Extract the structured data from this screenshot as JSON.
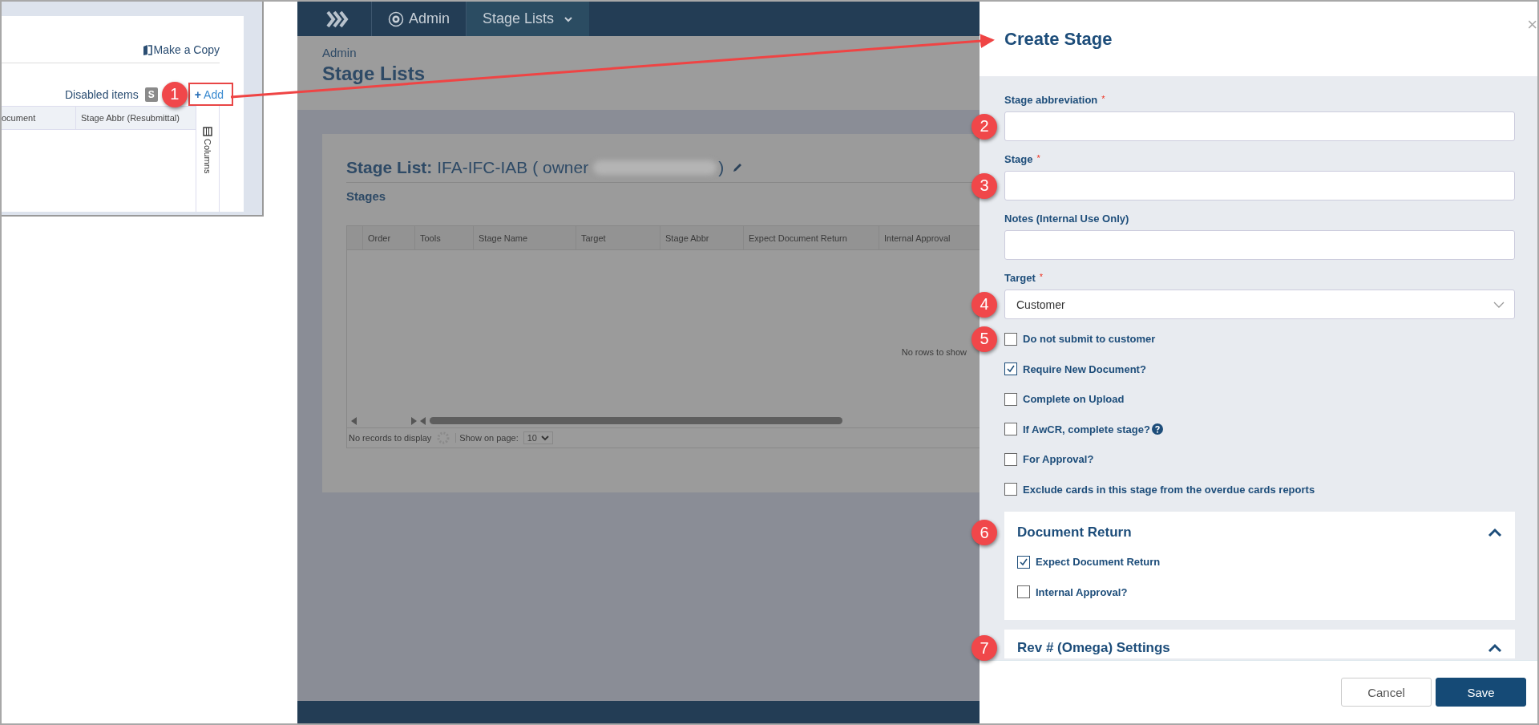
{
  "inset": {
    "make_copy": "Make a Copy",
    "disabled_items": "Disabled items",
    "badge": "S",
    "add_button": {
      "icon": "+",
      "label": "Add",
      "callout": "1"
    },
    "columns": [
      "ocument",
      "Stage Abbr (Resubmittal)"
    ],
    "columns_tab": "Columns"
  },
  "nav": {
    "crumbs": [
      {
        "label": "Admin",
        "kind": "gear",
        "selected": false
      },
      {
        "label": "Stage Lists",
        "kind": "dropdown",
        "selected": true
      }
    ]
  },
  "page": {
    "breadcrumb": "Admin",
    "title": "Stage Lists"
  },
  "stage_list": {
    "heading": "**Stage List:** IFA-IFC-IAB ( owner",
    "heading_end": ")",
    "section": "Stages"
  },
  "table": {
    "columns": [
      "Order",
      "Tools",
      "Stage Name",
      "Target",
      "Stage Abbr",
      "Expect Document Return",
      "Internal Approval"
    ],
    "empty": "No rows to show",
    "records": "No records to display",
    "show_label": "Show on page:",
    "page_size": "10"
  },
  "panel": {
    "title": "Create Stage",
    "close": "×",
    "fields": [
      {
        "label": "Stage abbreviation",
        "required_mark": "*",
        "kind": "text",
        "callout": "2"
      },
      {
        "label": "Stage",
        "required_mark": "*",
        "kind": "text",
        "callout": "3"
      },
      {
        "label": "Notes (Internal Use Only)",
        "kind": "text"
      },
      {
        "label": "Target",
        "required_mark": "*",
        "kind": "select",
        "value": "Customer",
        "callout": "4"
      }
    ],
    "checkboxes": [
      {
        "label": "Do not submit to customer",
        "checked": false,
        "help": false,
        "callout": "5"
      },
      {
        "label": "Require New Document?",
        "checked": true,
        "help": false
      },
      {
        "label": "Complete on Upload",
        "checked": false,
        "help": false
      },
      {
        "label": "If AwCR, complete stage?",
        "checked": false,
        "help": true
      },
      {
        "label": "For Approval?",
        "checked": false,
        "help": false
      },
      {
        "label": "Exclude cards in this stage from the overdue cards reports",
        "checked": false,
        "help": false
      }
    ],
    "sections": [
      {
        "title": "Document Return",
        "expanded": true,
        "callout": "6",
        "checkboxes": [
          {
            "label": "Expect Document Return",
            "checked": true,
            "help": false
          },
          {
            "label": "Internal Approval?",
            "checked": false,
            "help": false
          }
        ]
      },
      {
        "title": "Rev # (Omega) Settings",
        "expanded": true,
        "callout": "7"
      }
    ],
    "buttons": [
      {
        "label": "Cancel",
        "kind": "secondary"
      },
      {
        "label": "Save",
        "kind": "primary"
      }
    ]
  }
}
